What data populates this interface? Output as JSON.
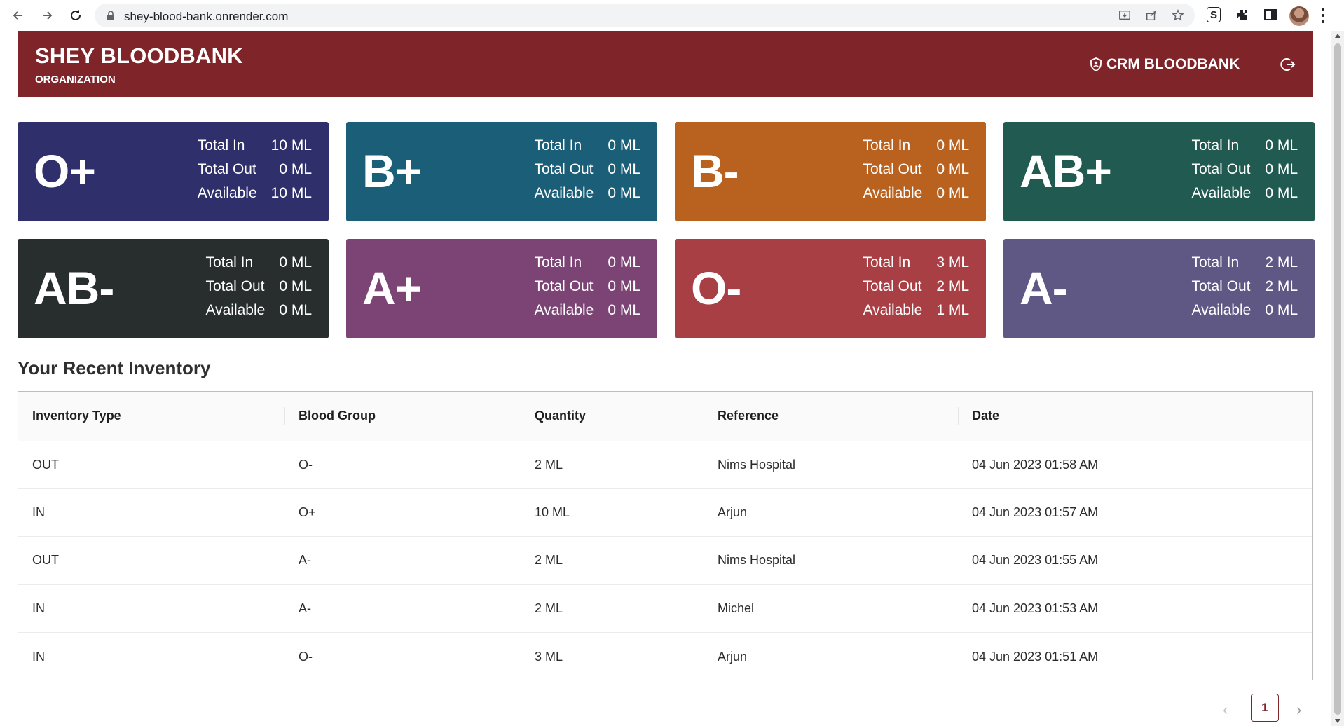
{
  "browser": {
    "url": "shey-blood-bank.onrender.com"
  },
  "header": {
    "title": "SHEY BLOODBANK",
    "subtitle": "ORGANIZATION",
    "crm_label": "CRM BLOODBANK"
  },
  "cards": [
    {
      "group": "O+",
      "total_in": "10 ML",
      "total_out": "0 ML",
      "available": "10 ML",
      "color": "#2e2f6b"
    },
    {
      "group": "B+",
      "total_in": "0 ML",
      "total_out": "0 ML",
      "available": "0 ML",
      "color": "#1b5e78"
    },
    {
      "group": "B-",
      "total_in": "0 ML",
      "total_out": "0 ML",
      "available": "0 ML",
      "color": "#b9621f"
    },
    {
      "group": "AB+",
      "total_in": "0 ML",
      "total_out": "0 ML",
      "available": "0 ML",
      "color": "#215a51"
    },
    {
      "group": "AB-",
      "total_in": "0 ML",
      "total_out": "0 ML",
      "available": "0 ML",
      "color": "#272e2d"
    },
    {
      "group": "A+",
      "total_in": "0 ML",
      "total_out": "0 ML",
      "available": "0 ML",
      "color": "#7c4474"
    },
    {
      "group": "O-",
      "total_in": "3 ML",
      "total_out": "2 ML",
      "available": "1 ML",
      "color": "#a83f45"
    },
    {
      "group": "A-",
      "total_in": "2 ML",
      "total_out": "2 ML",
      "available": "0 ML",
      "color": "#5f5784"
    }
  ],
  "labels": {
    "total_in": "Total In",
    "total_out": "Total Out",
    "available": "Available"
  },
  "inventory": {
    "title": "Your Recent Inventory",
    "columns": [
      "Inventory Type",
      "Blood Group",
      "Quantity",
      "Reference",
      "Date"
    ],
    "rows": [
      [
        "OUT",
        "O-",
        "2 ML",
        "Nims Hospital",
        "04 Jun 2023 01:58 AM"
      ],
      [
        "IN",
        "O+",
        "10 ML",
        "Arjun",
        "04 Jun 2023 01:57 AM"
      ],
      [
        "OUT",
        "A-",
        "2 ML",
        "Nims Hospital",
        "04 Jun 2023 01:55 AM"
      ],
      [
        "IN",
        "A-",
        "2 ML",
        "Michel",
        "04 Jun 2023 01:53 AM"
      ],
      [
        "IN",
        "O-",
        "3 ML",
        "Arjun",
        "04 Jun 2023 01:51 AM"
      ]
    ]
  },
  "pagination": {
    "current": "1",
    "prev_icon": "chevron-left-icon",
    "next_icon": "chevron-right-icon"
  },
  "colors": {
    "brand": "#7f2429"
  }
}
